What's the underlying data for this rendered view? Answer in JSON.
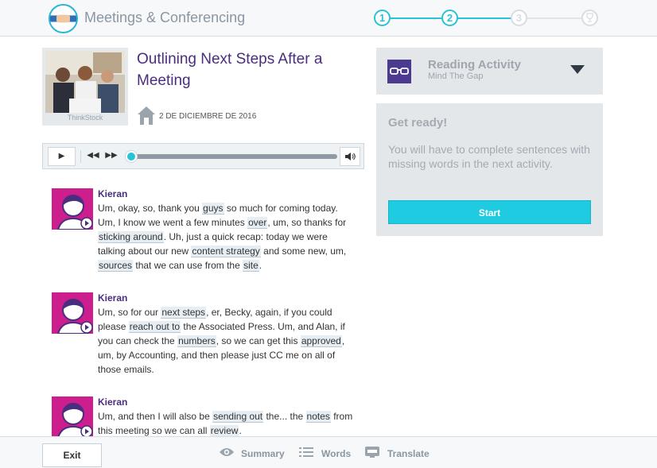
{
  "app": {
    "title": "Meetings & Conferencing"
  },
  "progress": {
    "steps": [
      {
        "label": "1",
        "state": "complete"
      },
      {
        "label": "2",
        "state": "current"
      },
      {
        "label": "3",
        "state": "upcoming"
      },
      {
        "label": "",
        "state": "upcoming",
        "icon": "trophy-icon"
      }
    ]
  },
  "lesson": {
    "title": "Outlining Next Steps After a Meeting",
    "image_credit": "ThinkStock",
    "date": "2 DE DICIEMBRE DE 2016"
  },
  "transcript": [
    {
      "speaker": "Kieran",
      "segments": [
        {
          "t": "Um, okay, so, thank you "
        },
        {
          "t": "guys",
          "hl": true
        },
        {
          "t": " so much for coming today. Um, I know we went a few minutes "
        },
        {
          "t": "over",
          "hl": true
        },
        {
          "t": ", um, so thanks for "
        },
        {
          "t": "sticking around",
          "hl": true
        },
        {
          "t": ". Uh, just a quick recap: today we were talking about our new "
        },
        {
          "t": "content strategy",
          "hl": true
        },
        {
          "t": " and some new, um, "
        },
        {
          "t": "sources",
          "hl": true
        },
        {
          "t": " that we can use from the "
        },
        {
          "t": "site",
          "hl": true
        },
        {
          "t": "."
        }
      ]
    },
    {
      "speaker": "Kieran",
      "segments": [
        {
          "t": "Um, so for our "
        },
        {
          "t": "next steps",
          "hl": true
        },
        {
          "t": ", er, Becky, again, if you could please "
        },
        {
          "t": "reach out to",
          "hl": true
        },
        {
          "t": " the Associated Press. Um, and Alan, if you can check the "
        },
        {
          "t": "numbers",
          "hl": true
        },
        {
          "t": ", so we can get this "
        },
        {
          "t": "approved",
          "hl": true
        },
        {
          "t": ", um, by Accounting, and then please just CC me on all of those emails."
        }
      ]
    },
    {
      "speaker": "Kieran",
      "segments": [
        {
          "t": "Um, and then I will also be "
        },
        {
          "t": "sending out",
          "hl": true
        },
        {
          "t": " the... the "
        },
        {
          "t": "notes",
          "hl": true
        },
        {
          "t": " from this meeting so we can all "
        },
        {
          "t": "review",
          "hl": true
        },
        {
          "t": "."
        }
      ]
    }
  ],
  "activity": {
    "title": "Reading Activity",
    "subtitle": "Mind The Gap",
    "icon": "glasses-icon"
  },
  "ready": {
    "title": "Get ready!",
    "text": "You will have to complete sentences with missing words in the next activity.",
    "start_label": "Start"
  },
  "footer": {
    "exit_label": "Exit",
    "summary_label": "Summary",
    "words_label": "Words",
    "translate_label": "Translate"
  },
  "colors": {
    "accent": "#1ecbe0",
    "purple": "#4b2d7f",
    "magenta": "#cc1e8c"
  }
}
